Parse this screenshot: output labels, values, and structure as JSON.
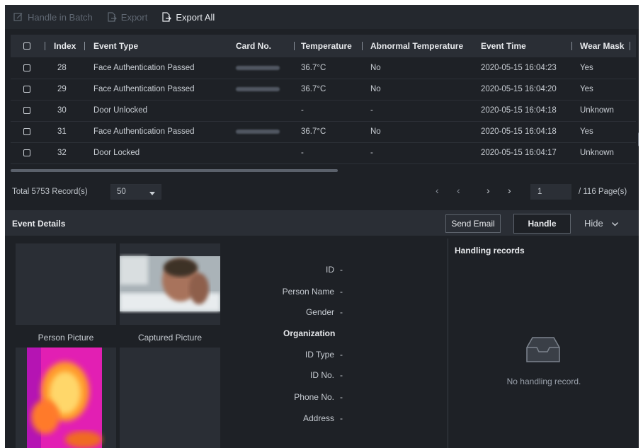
{
  "toolbar": {
    "handle_in_batch": "Handle in Batch",
    "export": "Export",
    "export_all": "Export All"
  },
  "table": {
    "headers": {
      "index": "Index",
      "event_type": "Event Type",
      "card_no": "Card No.",
      "temperature": "Temperature",
      "abnormal_temperature": "Abnormal Temperature",
      "event_time": "Event Time",
      "wear_mask": "Wear Mask"
    },
    "rows": [
      {
        "index": "28",
        "event_type": "Face Authentication Passed",
        "temperature": "36.7°C",
        "abnormal": "No",
        "time": "2020-05-15 16:04:23",
        "mask": "Yes",
        "card_blurred": true
      },
      {
        "index": "29",
        "event_type": "Face Authentication Passed",
        "temperature": "36.7°C",
        "abnormal": "No",
        "time": "2020-05-15 16:04:20",
        "mask": "Yes",
        "card_blurred": true
      },
      {
        "index": "30",
        "event_type": "Door Unlocked",
        "temperature": "-",
        "abnormal": "-",
        "time": "2020-05-15 16:04:18",
        "mask": "Unknown",
        "card_blurred": false
      },
      {
        "index": "31",
        "event_type": "Face Authentication Passed",
        "temperature": "36.7°C",
        "abnormal": "No",
        "time": "2020-05-15 16:04:18",
        "mask": "Yes",
        "card_blurred": true
      },
      {
        "index": "32",
        "event_type": "Door Locked",
        "temperature": "-",
        "abnormal": "-",
        "time": "2020-05-15 16:04:17",
        "mask": "Unknown",
        "card_blurred": false
      }
    ]
  },
  "pager": {
    "total": "Total 5753 Record(s)",
    "page_size": "50",
    "current_page": "1",
    "total_pages": "/ 116 Page(s)"
  },
  "details": {
    "title": "Event Details",
    "send_email": "Send Email",
    "handle": "Handle",
    "hide": "Hide",
    "person_picture": "Person Picture",
    "captured_picture": "Captured Picture",
    "fields": {
      "id": "ID",
      "person_name": "Person Name",
      "gender": "Gender",
      "organization": "Organization",
      "id_type": "ID Type",
      "id_no": "ID No.",
      "phone_no": "Phone No.",
      "address": "Address",
      "empty_value": "-"
    },
    "handling_records": "Handling records",
    "no_handling_record": "No handling record."
  },
  "colors": {
    "background": "#1e2126",
    "panel": "#2a2e35",
    "text": "#c9ced4"
  }
}
